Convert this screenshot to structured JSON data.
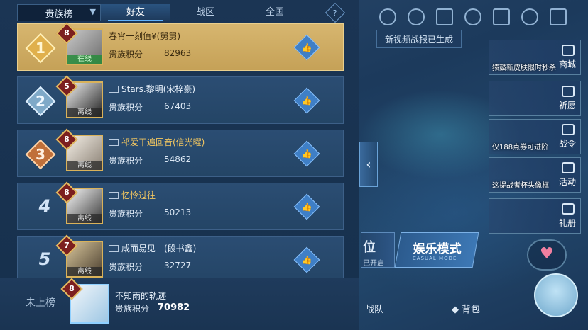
{
  "tabs": {
    "dropdown_label": "贵族榜",
    "items": [
      {
        "label": "好友",
        "active": true
      },
      {
        "label": "战区",
        "active": false
      },
      {
        "label": "全国",
        "active": false
      }
    ]
  },
  "rows": [
    {
      "rank": "1",
      "level": "8",
      "name": "春宵一刻值¥(舅舅)",
      "status": "在线",
      "points_label": "贵族积分",
      "points": "82963"
    },
    {
      "rank": "2",
      "level": "5",
      "name": "Stars.黎明(宋梓豪)",
      "status": "离线",
      "points_label": "贵族积分",
      "points": "67403"
    },
    {
      "rank": "3",
      "level": "8",
      "name": "祁爱干遍回音(信光曜)",
      "status": "离线",
      "points_label": "贵族积分",
      "points": "54862"
    },
    {
      "rank": "4",
      "level": "8",
      "name": "忆怜过往",
      "status": "离线",
      "points_label": "贵族积分",
      "points": "50213"
    },
    {
      "rank": "5",
      "level": "7",
      "name": "咸而易见　(段书鑫)",
      "status": "离线",
      "points_label": "贵族积分",
      "points": "32727"
    }
  ],
  "footer": {
    "unranked": "未上榜",
    "level": "8",
    "name": "不知雨的轨迹",
    "points_label": "贵族积分",
    "points": "70982"
  },
  "hud": {
    "notice": "新视频战报已生成",
    "side_buttons": [
      {
        "caption": "猿鼓新皮肤限时秒杀",
        "label": "商城"
      },
      {
        "caption": "",
        "label": "祈愿"
      },
      {
        "caption": "仅188点券可进阶",
        "label": "战令"
      },
      {
        "caption": "这提战者杯头像框",
        "label": "活动"
      },
      {
        "caption": "",
        "label": "礼册"
      }
    ],
    "mode_title": "娱乐模式",
    "mode_sub": "CASUAL MODE",
    "partial_title": "位",
    "partial_sub": "已开启",
    "bottom_team": "战队",
    "bottom_bag": "背包"
  },
  "colors": {
    "gold_row": "#d7b66f",
    "like_button": "#3f7fc6",
    "active_tab_line": "#5fb2ff"
  }
}
